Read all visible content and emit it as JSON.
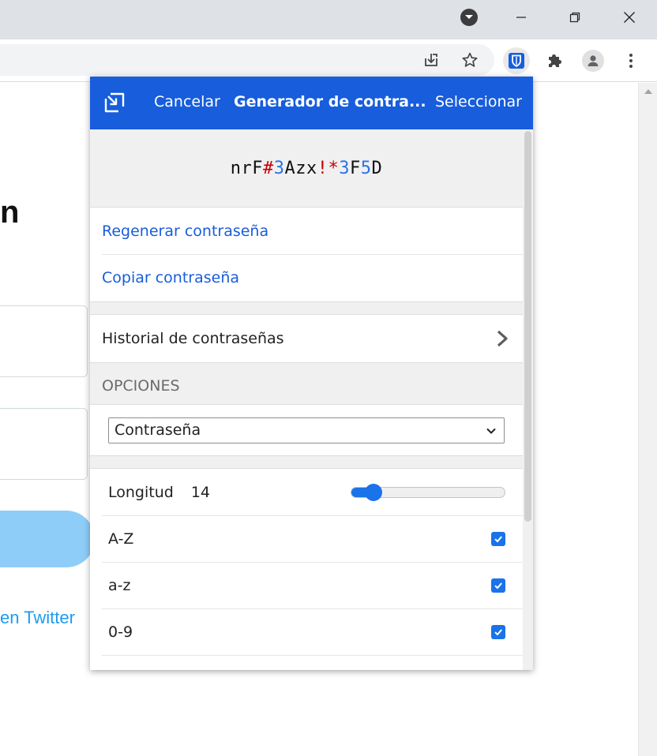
{
  "background_page": {
    "heading_fragment": "n",
    "link_fragment": "en Twitter"
  },
  "popup": {
    "header": {
      "cancel_label": "Cancelar",
      "title": "Generador de contra...",
      "select_label": "Seleccionar"
    },
    "generated_password": [
      "n",
      "r",
      "F",
      "#",
      "3",
      "A",
      "z",
      "x",
      "!",
      "*",
      "3",
      "F",
      "5",
      "D"
    ],
    "actions": {
      "regenerate": "Regenerar contraseña",
      "copy": "Copiar contraseña"
    },
    "history_label": "Historial de contraseñas",
    "options_heading": "OPCIONES",
    "type_select": {
      "selected": "Contraseña"
    },
    "options": {
      "length_label": "Longitud",
      "length_value": "14",
      "length_slider_fraction": 0.1,
      "uppercase_label": "A-Z",
      "uppercase_checked": true,
      "lowercase_label": "a-z",
      "lowercase_checked": true,
      "numbers_label": "0-9",
      "numbers_checked": true
    }
  },
  "colors": {
    "header_blue": "#175ddc",
    "link_blue": "#175ddc",
    "special_char_red": "#c70000",
    "number_char_blue": "#2a73e8",
    "control_blue": "#1a73e8"
  },
  "icons": {
    "profile_dropdown": "chevron-down-circle-icon",
    "minimize": "minimize-icon",
    "maximize": "restore-icon",
    "close": "close-icon",
    "install": "install-app-icon",
    "bookmark": "star-icon",
    "bitwarden": "bitwarden-shield-icon",
    "extensions": "puzzle-piece-icon",
    "profile": "person-icon",
    "menu": "kebab-menu-icon",
    "popout": "pop-out-icon",
    "history_chevron": "chevron-right-icon",
    "select_caret": "chevron-down-icon",
    "checkbox": "checkmark-icon"
  }
}
